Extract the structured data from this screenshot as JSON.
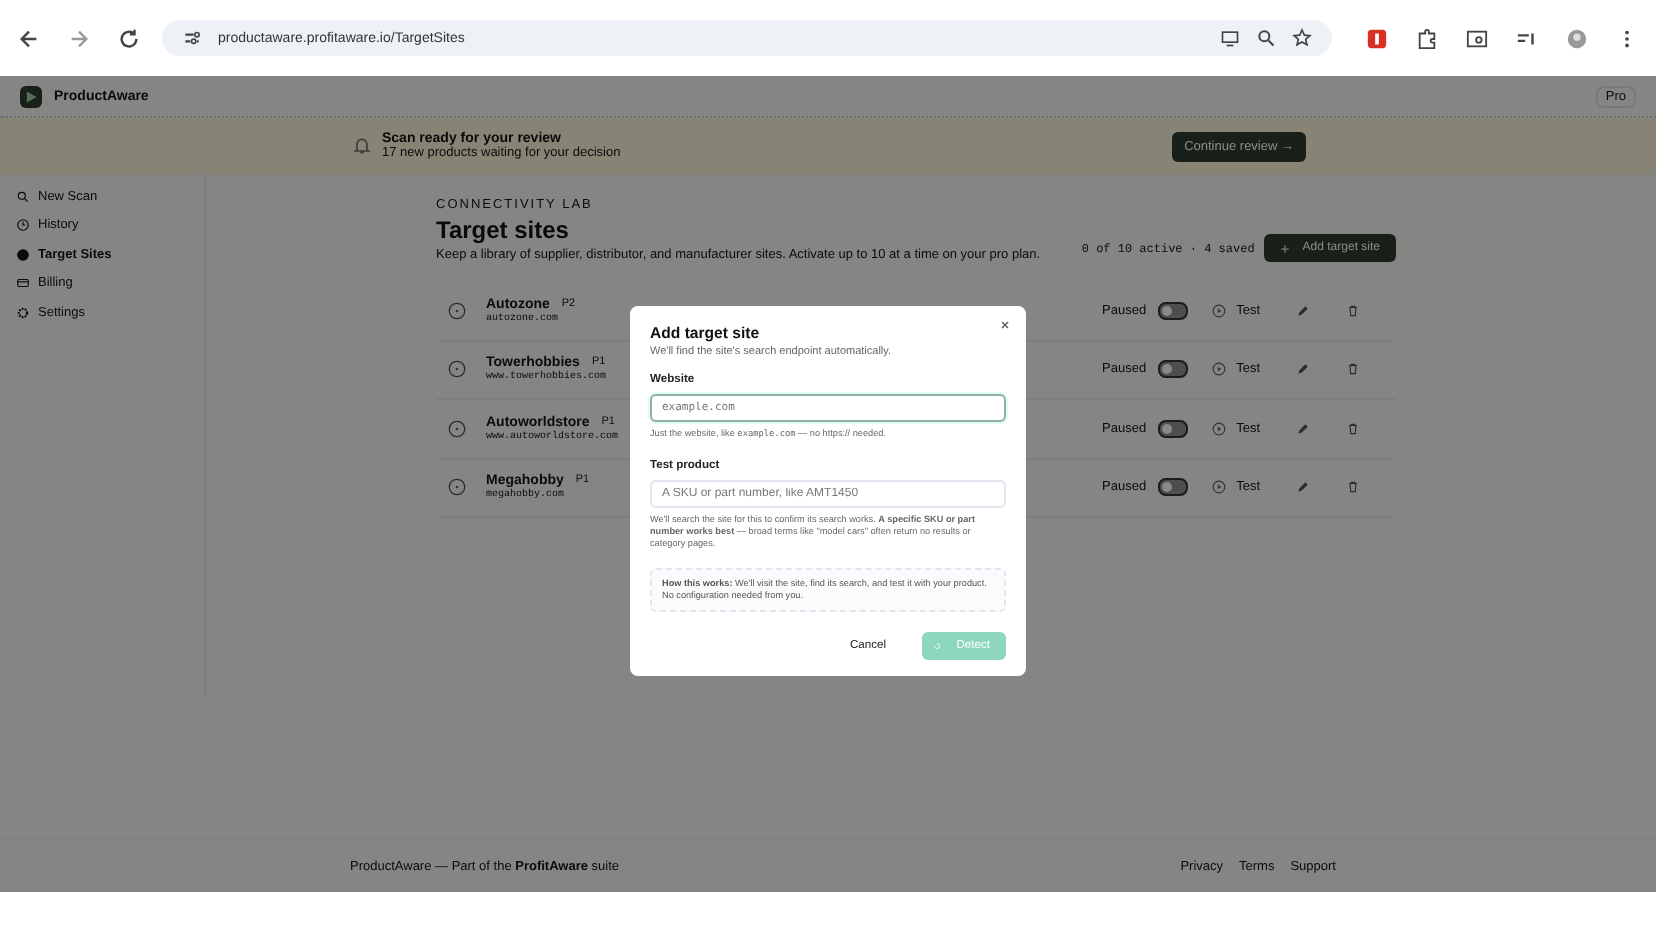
{
  "browser": {
    "url": "productaware.profitaware.io/TargetSites"
  },
  "app": {
    "name": "ProductAware",
    "plan": "Pro"
  },
  "banner": {
    "title": "Scan ready for your review",
    "subtitle": "17 new products waiting for your decision",
    "button": "Continue review →"
  },
  "sidebar": {
    "items": [
      {
        "label": "New Scan",
        "selected": false
      },
      {
        "label": "History",
        "selected": false
      },
      {
        "label": "Target Sites",
        "selected": true
      },
      {
        "label": "Billing",
        "selected": false
      },
      {
        "label": "Settings",
        "selected": false
      }
    ]
  },
  "header": {
    "eyebrow": "CONNECTIVITY LAB",
    "title": "Target sites",
    "subtitle": "Keep a library of supplier, distributor, and manufacturer sites. Activate up to 10 at a time on your pro plan.",
    "counter": "0 of 10 active · 4 saved",
    "add_button": "Add target site"
  },
  "sites": [
    {
      "name": "Autozone",
      "priority": "P2",
      "domain": "autozone.com",
      "status": "Paused",
      "active": false,
      "test": "Test"
    },
    {
      "name": "Towerhobbies",
      "priority": "P1",
      "domain": "www.towerhobbies.com",
      "status": "Paused",
      "active": false,
      "test": "Test"
    },
    {
      "name": "Autoworldstore",
      "priority": "P1",
      "domain": "www.autoworldstore.com",
      "status": "Paused",
      "active": false,
      "test": "Test"
    },
    {
      "name": "Megahobby",
      "priority": "P1",
      "domain": "megahobby.com",
      "status": "Paused",
      "active": false,
      "test": "Test"
    }
  ],
  "footer": {
    "text": "ProductAware — Part of the **ProfitAware** suite",
    "links": [
      "Privacy",
      "Terms",
      "Support"
    ]
  },
  "modal": {
    "title": "Add target site",
    "subtitle": "We'll find the site's search endpoint automatically.",
    "website": {
      "label": "Website",
      "placeholder": "example.com",
      "focused": true,
      "hint": [
        {
          "kind": "text",
          "text": "Just the website, like "
        },
        {
          "kind": "code",
          "text": "example.com"
        },
        {
          "kind": "text",
          "text": " — no https:// needed."
        }
      ]
    },
    "product": {
      "label": "Test product",
      "placeholder": "A SKU or part number, like AMT1450",
      "hint": "We'll search the site for this to confirm its search works. **A specific SKU or part number works best** — broad terms like \"model cars\" often return no results or category pages."
    },
    "info": "**How this works:** We'll visit the site, find its search, and test it with your product. No configuration needed from you.",
    "cancel": "Cancel",
    "submit": {
      "label": "Detect",
      "disabled": true
    }
  }
}
